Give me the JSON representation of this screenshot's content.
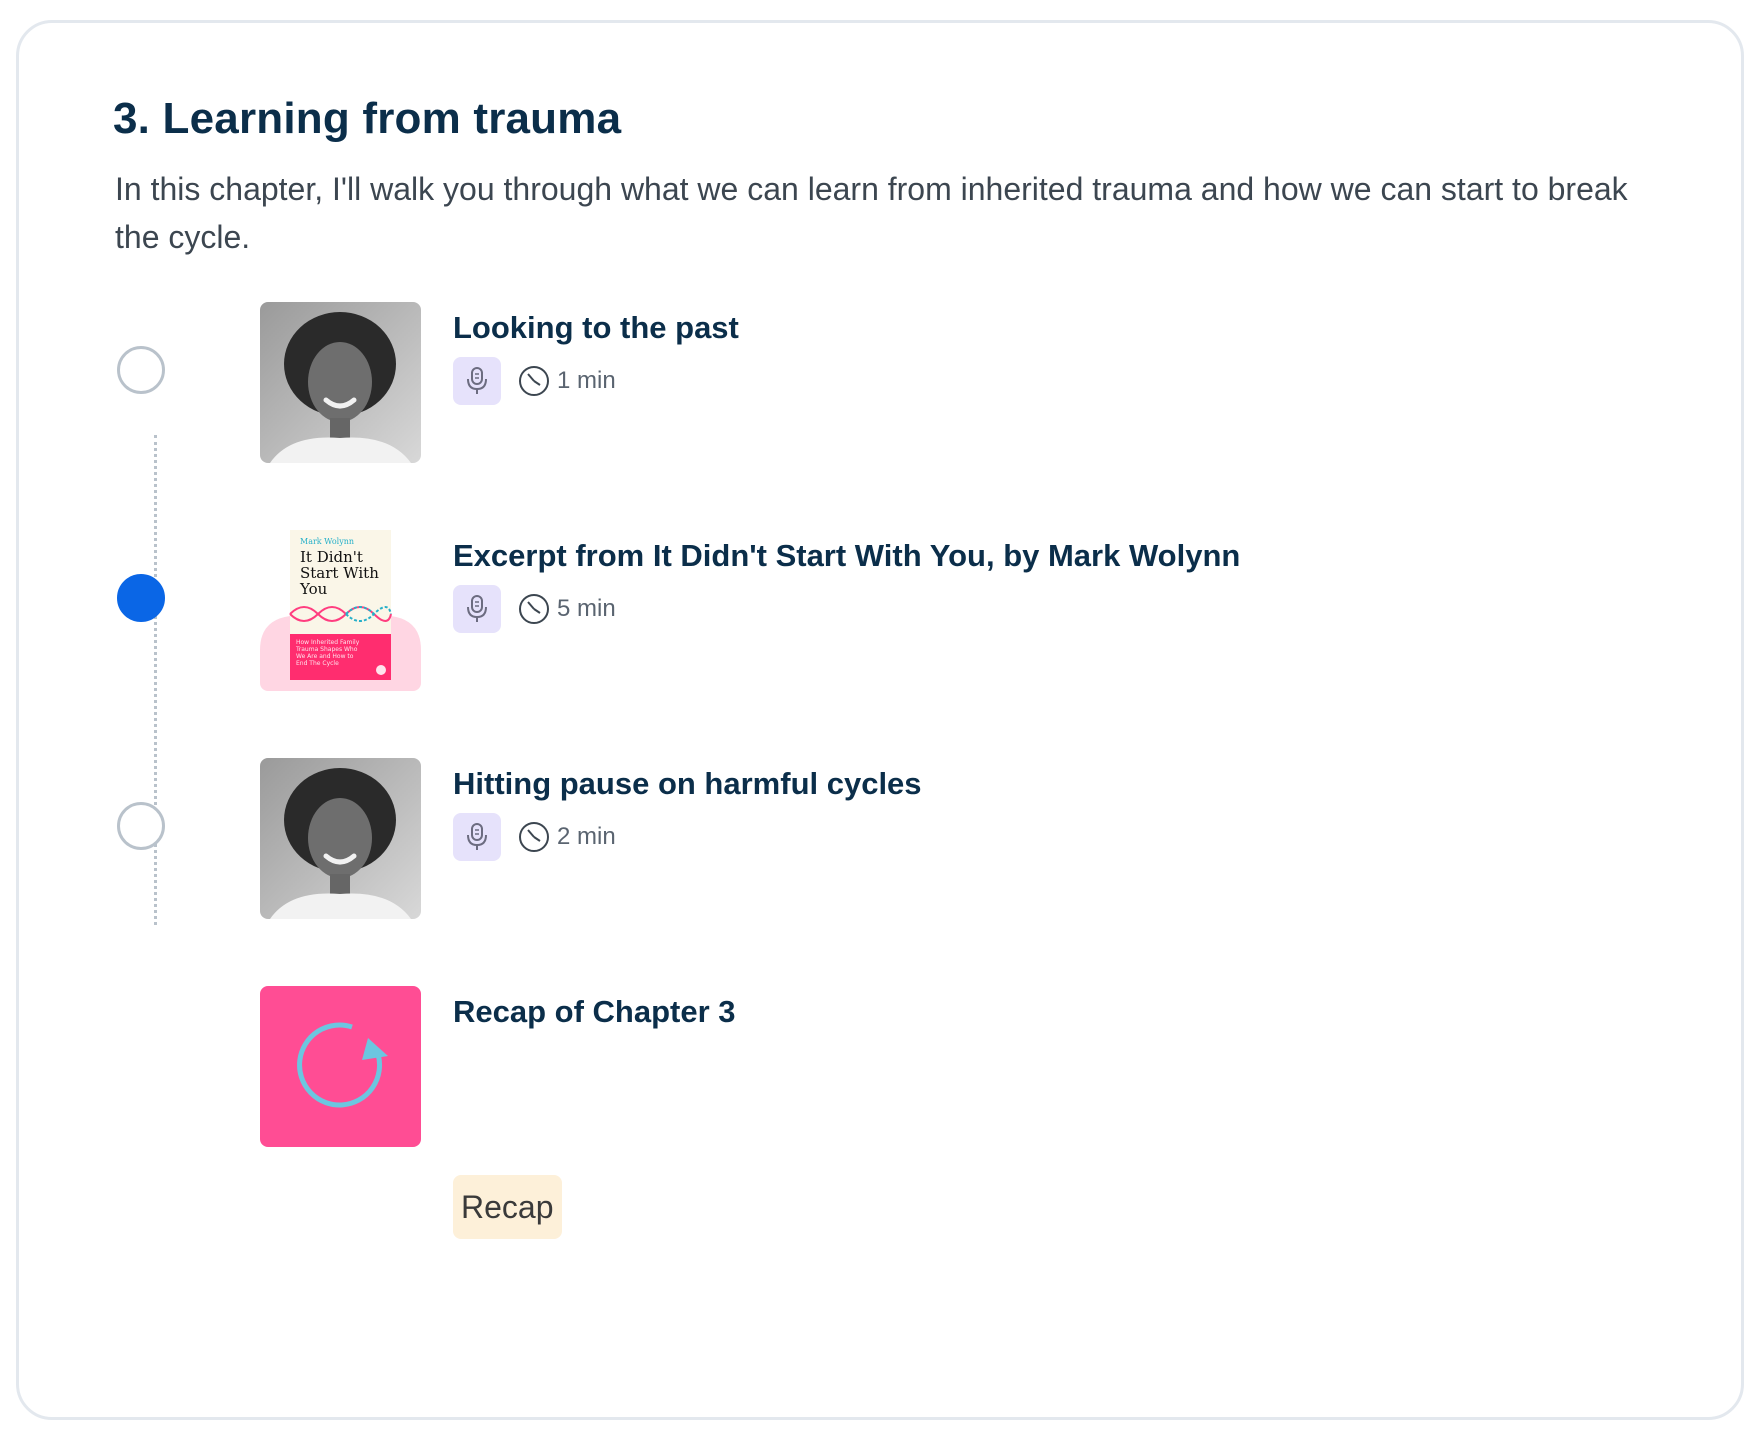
{
  "chapter": {
    "title": "3. Learning from trauma",
    "description": "In this chapter, I'll walk you through what we can learn from inherited trauma and how we can start to break the cycle."
  },
  "items": [
    {
      "title": "Looking to the past",
      "duration": "1 min",
      "type_icon": "microphone-icon",
      "status": "not-started"
    },
    {
      "title": "Excerpt from It Didn't Start With You, by Mark Wolynn",
      "duration": "5 min",
      "type_icon": "microphone-icon",
      "status": "current",
      "book_cover": {
        "author": "Mark Wolynn",
        "title_lines": [
          "It Didn't",
          "Start With",
          "You"
        ],
        "subtitle_lines": [
          "How Inherited Family",
          "Trauma Shapes Who",
          "We Are and How to",
          "End The Cycle"
        ]
      }
    },
    {
      "title": "Hitting pause on harmful cycles",
      "duration": "2 min",
      "type_icon": "microphone-icon",
      "status": "not-started"
    },
    {
      "title": "Recap of Chapter 3",
      "tag": "Recap",
      "type_icon": "refresh-icon"
    }
  ],
  "colors": {
    "heading": "#0b2e4a",
    "current_dot": "#0a66e6",
    "mic_chip_bg": "#e6e2fb",
    "recap_thumb_bg": "#ff4d94",
    "recap_arrow": "#6cc6e0",
    "recap_chip_bg": "#fdf0d9"
  }
}
